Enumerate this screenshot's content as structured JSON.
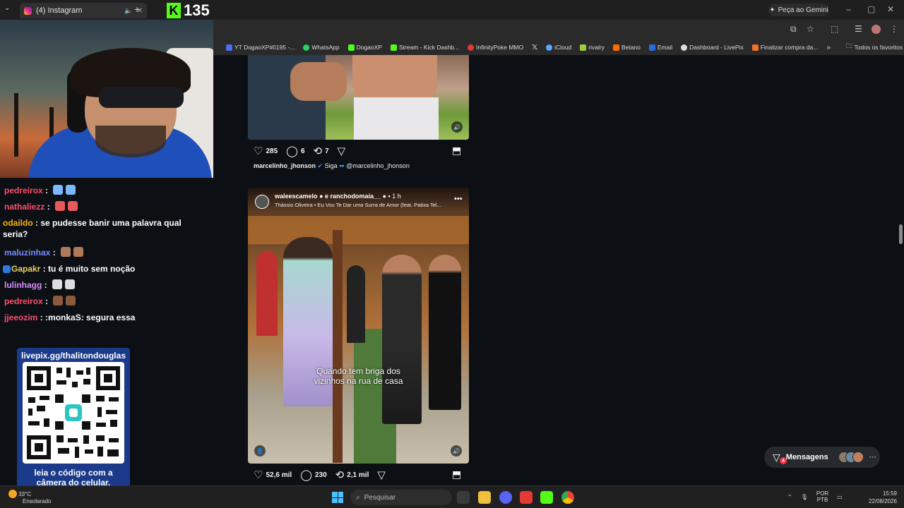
{
  "browser": {
    "tab_title": "(4) Instagram",
    "gemini_label": "Peça ao Gemini",
    "bookmarks": [
      {
        "label": "YT DogaoXP#0195 -...",
        "color": "#4a6cf7"
      },
      {
        "label": "WhatsApp",
        "color": "#25d366"
      },
      {
        "label": "DogaoXP",
        "color": "#53fc18"
      },
      {
        "label": "Stream - Kick Dashb...",
        "color": "#53fc18"
      },
      {
        "label": "InfinityPoke MMO",
        "color": "#e53935"
      },
      {
        "label": "",
        "color": "#ffffff"
      },
      {
        "label": "iCloud",
        "color": "#5aa7ff"
      },
      {
        "label": "rivalry",
        "color": "#9ccc3c"
      },
      {
        "label": "Betano",
        "color": "#ff6b00"
      },
      {
        "label": "Email",
        "color": "#2a6ae0"
      },
      {
        "label": "Dashboard - LivePix",
        "color": "#dddddd"
      },
      {
        "label": "Finalizar compra da...",
        "color": "#f57224"
      }
    ],
    "all_bookmarks": "Todos os favoritos"
  },
  "overlay": {
    "kick_logo": "K",
    "viewer_count": "135"
  },
  "chat": [
    {
      "user": "pedreirox",
      "color": "#ff4d6d",
      "text": ""
    },
    {
      "user": "nathaliezz",
      "color": "#ff4d6d",
      "text": ""
    },
    {
      "user": "odaildo",
      "color": "#ffb300",
      "text": "se pudesse banir uma palavra qual seria?"
    },
    {
      "user": "maluzinhax",
      "color": "#7a8cff",
      "text": ""
    },
    {
      "user": "Gapakr",
      "color": "#e8d36a",
      "text": "tu é muito sem noção"
    },
    {
      "user": "lulinhagg",
      "color": "#d98cff",
      "text": ""
    },
    {
      "user": "pedreirox",
      "color": "#ff4d6d",
      "text": ""
    },
    {
      "user": "jjeeozim",
      "color": "#ff4d6d",
      "text": ":monkaS: segura essa"
    }
  ],
  "qr": {
    "url": "livepix.gg/thalitondouglas",
    "text_line1": "leia o código com a",
    "text_line2": "câmera do celular."
  },
  "post1": {
    "likes": "285",
    "comments": "6",
    "reposts": "7",
    "caption_user": "marcelinho_jhonson",
    "follow": "Siga",
    "mention": "@marcelinho_jhonson"
  },
  "post2": {
    "user": "waleescamelo",
    "and": "e",
    "coauthor": "ranchodomaia__",
    "time": "1 h",
    "song": "Thássio Oliveira • Eu Vou Te Dar uma Surra de Amor (feat. Patixa Tel...",
    "overlay_line1": "Quando tem briga dos",
    "overlay_line2": "vizinhos na rua de casa",
    "likes": "52,6 mil",
    "comments": "230",
    "reposts": "2,1 mil"
  },
  "messages": {
    "label": "Mensagens",
    "badge": "4"
  },
  "taskbar": {
    "weather_temp": "33°C",
    "weather_desc": "Ensolarado",
    "search_placeholder": "Pesquisar",
    "lang": "POR",
    "layout": "PTB",
    "time": "15:59",
    "date": "22/08/2026"
  }
}
